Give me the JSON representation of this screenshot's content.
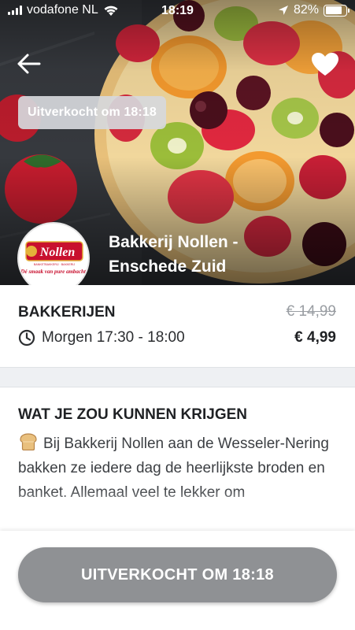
{
  "status_bar": {
    "carrier": "vodafone NL",
    "time": "18:19",
    "battery_percent": "82%",
    "battery_level": 0.82
  },
  "hero": {
    "soldout_badge": "Uitverkocht om 18:18",
    "store_name": "Bakkerij Nollen -\nEnschede Zuid",
    "logo": {
      "brand": "Nollen",
      "ribbon": "BANKETBAKKERIJ · BAKKERIJ",
      "tagline": "Dé smaak van pure ambacht!"
    }
  },
  "info": {
    "category": "BAKKERIJEN",
    "pickup_time": "Morgen 17:30 - 18:00",
    "old_price": "€ 14,99",
    "new_price": "€ 4,99"
  },
  "section": {
    "title": "WAT JE ZOU KUNNEN KRIJGEN",
    "icon": "bread-emoji",
    "description": "Bij Bakkerij Nollen aan de Wesseler-Nering bakken ze iedere dag de heerlijkste broden en banket. Allemaal veel te lekker om"
  },
  "cta": {
    "label": "UITVERKOCHT OM 18:18",
    "color": "#8f9194"
  },
  "colors": {
    "logo_red": "#c8102e",
    "logo_gold": "#e4b23a"
  }
}
